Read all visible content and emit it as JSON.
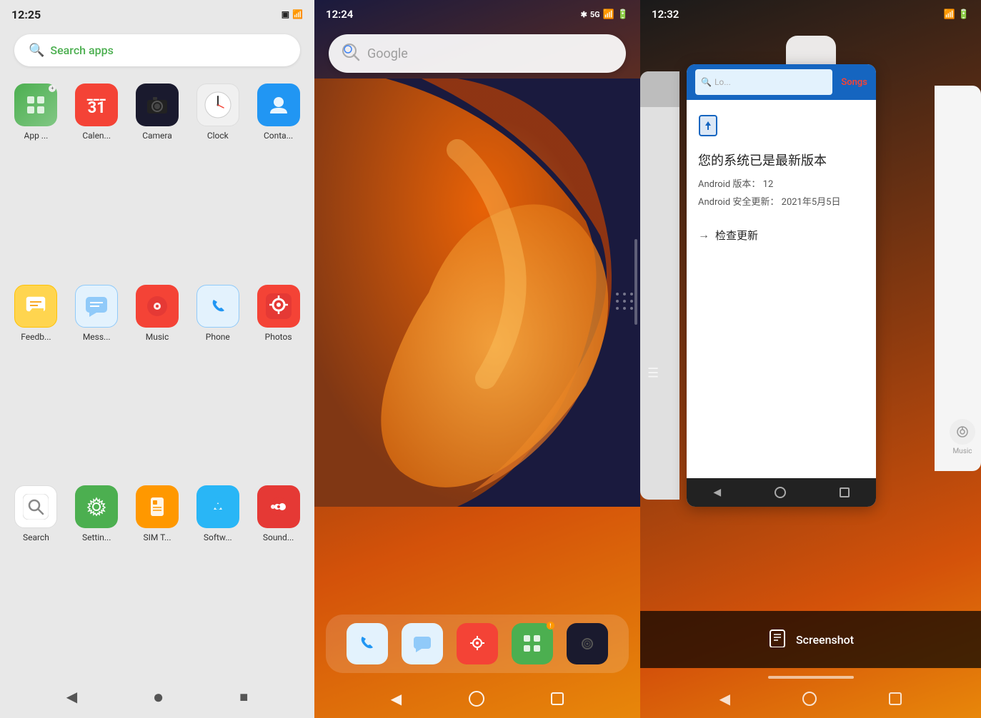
{
  "panel1": {
    "status": {
      "time": "12:25",
      "icons": "📶🔋"
    },
    "search_placeholder": "Search apps",
    "apps": [
      {
        "id": "appvault",
        "label": "App ...",
        "icon": "⊞",
        "color_class": "icon-appvault"
      },
      {
        "id": "calendar",
        "label": "Calen...",
        "icon": "31",
        "color_class": "icon-calendar"
      },
      {
        "id": "camera",
        "label": "Camera",
        "icon": "📷",
        "color_class": "icon-camera"
      },
      {
        "id": "clock",
        "label": "Clock",
        "icon": "🕐",
        "color_class": "icon-clock"
      },
      {
        "id": "contacts",
        "label": "Conta...",
        "icon": "👤",
        "color_class": "icon-contacts"
      },
      {
        "id": "feedback",
        "label": "Feedb...",
        "icon": "💬",
        "color_class": "icon-feedback"
      },
      {
        "id": "messages",
        "label": "Mess...",
        "icon": "💬",
        "color_class": "icon-messages"
      },
      {
        "id": "music",
        "label": "Music",
        "icon": "🎵",
        "color_class": "icon-music"
      },
      {
        "id": "phone",
        "label": "Phone",
        "icon": "📞",
        "color_class": "icon-phone"
      },
      {
        "id": "photos",
        "label": "Photos",
        "icon": "🌸",
        "color_class": "icon-photos"
      },
      {
        "id": "search",
        "label": "Search",
        "icon": "🔍",
        "color_class": "icon-search"
      },
      {
        "id": "settings",
        "label": "Settin...",
        "icon": "⚙",
        "color_class": "icon-settings"
      },
      {
        "id": "simt",
        "label": "SIM T...",
        "icon": "📋",
        "color_class": "icon-simt"
      },
      {
        "id": "software",
        "label": "Softw...",
        "icon": "⬆",
        "color_class": "icon-softw"
      },
      {
        "id": "soundrecorder",
        "label": "Sound...",
        "icon": "🎙",
        "color_class": "icon-sound"
      }
    ],
    "nav": {
      "back": "◀",
      "home": "●",
      "recents": "■"
    }
  },
  "panel2": {
    "status": {
      "time": "12:24",
      "right_icons": "5G 🔋"
    },
    "search_placeholder": "Google",
    "dock_apps": [
      {
        "id": "phone",
        "icon": "📞",
        "bg": "#e3f2fd"
      },
      {
        "id": "messages",
        "icon": "💬",
        "bg": "#e3f2fd"
      },
      {
        "id": "photos",
        "icon": "🌸",
        "bg": "#f44336"
      },
      {
        "id": "appvault",
        "icon": "⊞",
        "bg": "#4caf50"
      },
      {
        "id": "camera",
        "icon": "⬤",
        "bg": "#1a1a2e"
      }
    ],
    "nav": {
      "back": "◀",
      "home": "○",
      "recents": "□"
    }
  },
  "panel3": {
    "status": {
      "time": "12:32",
      "right_icons": "WiFi 🔋"
    },
    "update_card": {
      "title": "您的系统已是最新版本",
      "android_version_label": "Android 版本：",
      "android_version": "12",
      "security_update_label": "Android 安全更新：",
      "security_update": "2021年5月5日",
      "check_update": "检查更新",
      "tab_songs": "Songs",
      "search_hint": "Lo..."
    },
    "screenshot_label": "Screenshot",
    "nav": {
      "back": "◀",
      "home": "○",
      "recents": "□"
    }
  }
}
